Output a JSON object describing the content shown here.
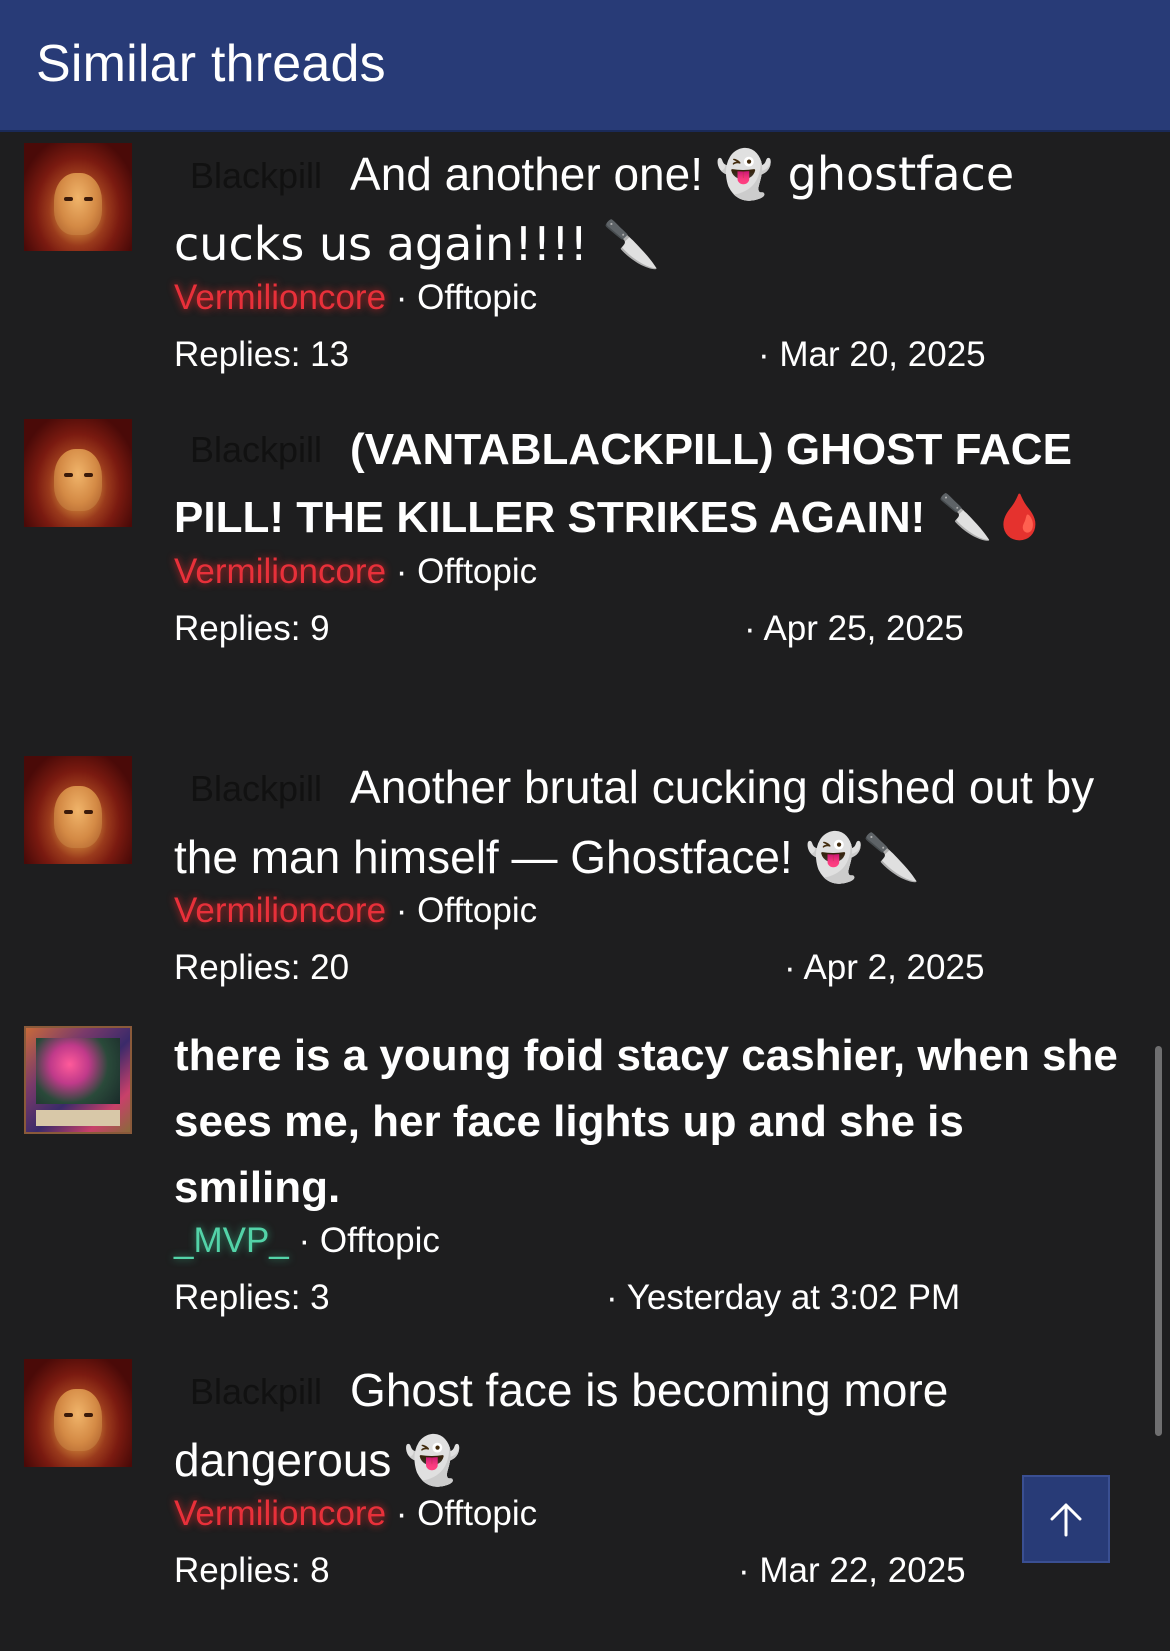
{
  "header": {
    "title": "Similar threads"
  },
  "threads": [
    {
      "prefix": "Blackpill",
      "title": "And another one!",
      "title_emojis": "👻 ghostface cucks us again!!!! 🔪",
      "author": "Vermilioncore",
      "forum": "Offtopic",
      "replies": "Replies: 13",
      "date": "· Mar 20, 2025",
      "avatar": "hooded-man-avatar"
    },
    {
      "prefix": "Blackpill",
      "title": "(VANTABLACKPILL) GHOST FACE PILL! THE KILLER STRIKES AGAIN!",
      "title_emojis": "🔪🩸",
      "author": "Vermilioncore",
      "forum": "Offtopic",
      "replies": "Replies: 9",
      "date": "· Apr 25, 2025",
      "avatar": "hooded-man-avatar"
    },
    {
      "prefix": "Blackpill",
      "title": "Another brutal cucking dished out by the man himself — Ghostface!",
      "title_emojis": "👻🔪",
      "author": "Vermilioncore",
      "forum": "Offtopic",
      "replies": "Replies: 20",
      "date": "· Apr 2, 2025",
      "avatar": "hooded-man-avatar"
    },
    {
      "prefix": "",
      "title": "there is a young foid stacy cashier, when she sees me, her face lights up and she is smiling.",
      "title_emojis": "",
      "author": "_MVP_",
      "forum": "Offtopic",
      "replies": "Replies: 3",
      "date": "· Yesterday at 3:02 PM",
      "avatar": "trading-card-avatar"
    },
    {
      "prefix": "Blackpill",
      "title": "Ghost face is becoming more dangerous",
      "title_emojis": "👻",
      "author": "Vermilioncore",
      "forum": "Offtopic",
      "replies": "Replies: 8",
      "date": "· Mar 22, 2025",
      "avatar": "hooded-man-avatar"
    }
  ],
  "separator": "·",
  "scroll_top": {
    "icon": "arrow-up-icon"
  },
  "colors": {
    "header_bg": "#283b77",
    "page_bg": "#1e1e1f",
    "author_red": "#e8303a",
    "author_green": "#53d3a8"
  }
}
